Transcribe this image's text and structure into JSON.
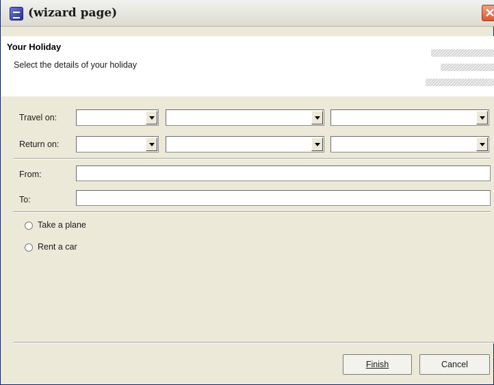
{
  "window": {
    "title": "(wizard page)"
  },
  "header": {
    "title": "Your Holiday",
    "description": "Select the details of your holiday"
  },
  "form": {
    "travel_on_label": "Travel on:",
    "return_on_label": "Return on:",
    "travel_on_values": [
      "",
      "",
      ""
    ],
    "return_on_values": [
      "",
      "",
      ""
    ],
    "from_label": "From:",
    "from_value": "",
    "to_label": "To:",
    "to_value": "",
    "options": [
      {
        "label": "Take a plane",
        "selected": false
      },
      {
        "label": "Rent a car",
        "selected": false
      }
    ]
  },
  "buttons": {
    "finish": "Finish",
    "cancel": "Cancel"
  },
  "colors": {
    "dialog_bg": "#ece9d8",
    "header_bg": "#ffffff",
    "close_button": "#d65a34"
  }
}
